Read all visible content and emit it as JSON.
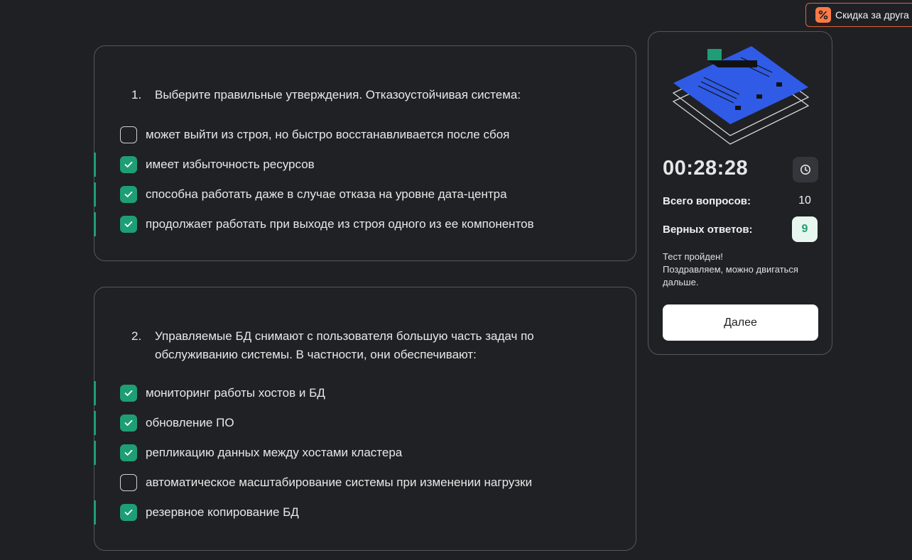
{
  "promo": {
    "label": "Скидка за друга",
    "icon": "discount-percent-icon",
    "color": "#ff7a45"
  },
  "questions": [
    {
      "number": "1.",
      "text": "Выберите правильные утверждения. Отказоустойчивая система:",
      "options": [
        {
          "label": "может выйти из строя, но быстро восстанавливается после сбоя",
          "checked": false
        },
        {
          "label": "имеет избыточность ресурсов",
          "checked": true
        },
        {
          "label": "способна работать даже в случае отказа на уровне дата-центра",
          "checked": true
        },
        {
          "label": "продолжает работать при выходе из строя одного из ее компонентов",
          "checked": true
        }
      ]
    },
    {
      "number": "2.",
      "text": "Управляемые БД снимают с пользователя большую часть задач по обслуживанию системы. В частности, они обеспечивают:",
      "options": [
        {
          "label": "мониторинг работы хостов и БД",
          "checked": true
        },
        {
          "label": "обновление ПО",
          "checked": true
        },
        {
          "label": "репликацию данных между хостами кластера",
          "checked": true
        },
        {
          "label": "автоматическое масштабирование системы при изменении нагрузки",
          "checked": false
        },
        {
          "label": "резервное копирование БД",
          "checked": true
        }
      ]
    }
  ],
  "panel": {
    "timer": "00:28:28",
    "clock_icon": "clock-icon",
    "total_label": "Всего вопросов:",
    "total_value": "10",
    "correct_label": "Верных ответов:",
    "correct_value": "9",
    "result_line1": "Тест пройден!",
    "result_line2": "Поздравляем, можно двигаться дальше.",
    "next_label": "Далее"
  },
  "colors": {
    "accent_green": "#1e9e74",
    "illustration_blue": "#2f5be6",
    "background": "#1f2024"
  }
}
